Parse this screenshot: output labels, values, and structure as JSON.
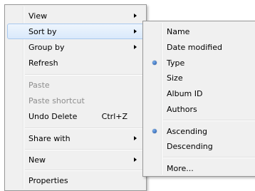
{
  "context_menu": {
    "items": [
      {
        "label": "View"
      },
      {
        "label": "Sort by"
      },
      {
        "label": "Group by"
      },
      {
        "label": "Refresh"
      },
      {
        "label": "Paste"
      },
      {
        "label": "Paste shortcut"
      },
      {
        "label": "Undo Delete",
        "shortcut": "Ctrl+Z"
      },
      {
        "label": "Share with"
      },
      {
        "label": "New"
      },
      {
        "label": "Properties"
      }
    ]
  },
  "sort_submenu": {
    "items": [
      {
        "label": "Name"
      },
      {
        "label": "Date modified"
      },
      {
        "label": "Type",
        "selected": true
      },
      {
        "label": "Size"
      },
      {
        "label": "Album ID"
      },
      {
        "label": "Authors"
      },
      {
        "label": "Ascending",
        "selected": true
      },
      {
        "label": "Descending"
      },
      {
        "label": "More..."
      }
    ]
  }
}
